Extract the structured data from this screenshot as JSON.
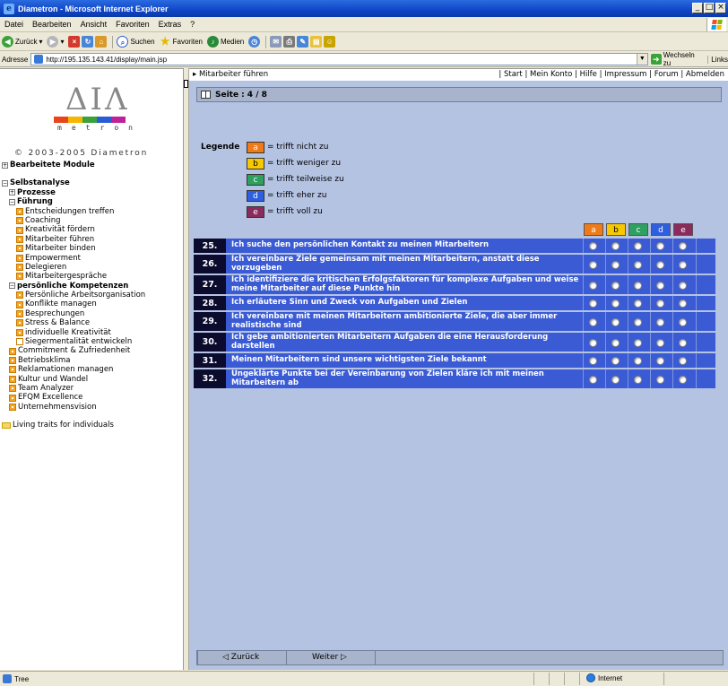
{
  "window": {
    "title": "Diametron - Microsoft Internet Explorer"
  },
  "menu": [
    "Datei",
    "Bearbeiten",
    "Ansicht",
    "Favoriten",
    "Extras",
    "?"
  ],
  "toolbar": {
    "back": "Zurück",
    "search": "Suchen",
    "favorites": "Favoriten",
    "media": "Medien"
  },
  "address": {
    "label": "Adresse",
    "url": "http://195.135.143.41/display/main.jsp",
    "go": "Wechseln zu",
    "links": "Links"
  },
  "logo": {
    "glyphs": "ΔΙΛ",
    "word": [
      "m",
      "e",
      "t",
      "r",
      "o",
      "n"
    ],
    "colors": [
      "#e8451a",
      "#f7b500",
      "#3aa23a",
      "#2a5cd6",
      "#c0219a"
    ]
  },
  "copyright": "© 2003-2005 Diametron",
  "nav": [
    {
      "label": "Bearbeitete Module",
      "level": 0,
      "type": "plus",
      "bold": true
    },
    {
      "label": "Selbstanalyse",
      "level": 0,
      "type": "minus",
      "bold": true
    },
    {
      "label": "Prozesse",
      "level": 1,
      "type": "plus",
      "bold": true
    },
    {
      "label": "Führung",
      "level": 1,
      "type": "minus",
      "bold": true
    },
    {
      "label": "Entscheidungen treffen",
      "level": 2,
      "type": "bullet"
    },
    {
      "label": "Coaching",
      "level": 2,
      "type": "bullet"
    },
    {
      "label": "Kreativität fördern",
      "level": 2,
      "type": "bullet"
    },
    {
      "label": "Mitarbeiter führen",
      "level": 2,
      "type": "bullet"
    },
    {
      "label": "Mitarbeiter binden",
      "level": 2,
      "type": "bullet"
    },
    {
      "label": "Empowerment",
      "level": 2,
      "type": "bullet"
    },
    {
      "label": "Delegieren",
      "level": 2,
      "type": "bullet"
    },
    {
      "label": "Mitarbeitergespräche",
      "level": 2,
      "type": "bullet"
    },
    {
      "label": "persönliche Kompetenzen",
      "level": 1,
      "type": "minus",
      "bold": true
    },
    {
      "label": "Persönliche Arbeitsorganisation",
      "level": 2,
      "type": "bullet"
    },
    {
      "label": "Konflikte managen",
      "level": 2,
      "type": "bullet"
    },
    {
      "label": "Besprechungen",
      "level": 2,
      "type": "bullet"
    },
    {
      "label": "Stress & Balance",
      "level": 2,
      "type": "bullet"
    },
    {
      "label": "individuelle Kreativität",
      "level": 2,
      "type": "bullet"
    },
    {
      "label": "Siegermentalität entwickeln",
      "level": 2,
      "type": "empty"
    },
    {
      "label": "Commitment & Zufriedenheit",
      "level": 1,
      "type": "bullet"
    },
    {
      "label": "Betriebsklima",
      "level": 1,
      "type": "bullet"
    },
    {
      "label": "Reklamationen managen",
      "level": 1,
      "type": "bullet"
    },
    {
      "label": "Kultur und Wandel",
      "level": 1,
      "type": "bullet"
    },
    {
      "label": "Team Analyzer",
      "level": 1,
      "type": "bullet"
    },
    {
      "label": "EFQM Excellence",
      "level": 1,
      "type": "bullet"
    },
    {
      "label": "Unternehmensvision",
      "level": 1,
      "type": "bullet"
    },
    {
      "label": "",
      "level": 0,
      "type": "spacer"
    },
    {
      "label": "Living traits for individuals",
      "level": 0,
      "type": "folder"
    }
  ],
  "topnav": {
    "crumb": "▸ Mitarbeiter führen",
    "links": "| Start | Mein Konto | Hilfe | Impressum | Forum | Abmelden"
  },
  "page": {
    "label": "Seite",
    "value": ": 4 / 8"
  },
  "legend": {
    "title": "Legende",
    "items": [
      {
        "key": "a",
        "color": "#f07a18",
        "text": "= trifft nicht zu"
      },
      {
        "key": "b",
        "color": "#f7c800",
        "text": "= trifft weniger zu"
      },
      {
        "key": "c",
        "color": "#2fa060",
        "text": "= trifft teilweise zu"
      },
      {
        "key": "d",
        "color": "#2e5fe0",
        "text": "= trifft eher zu"
      },
      {
        "key": "e",
        "color": "#8b2a5c",
        "text": "= trifft voll zu"
      }
    ]
  },
  "questions": [
    {
      "num": "25.",
      "text": "Ich suche den persönlichen Kontakt zu meinen Mitarbeitern"
    },
    {
      "num": "26.",
      "text": "Ich vereinbare Ziele gemeinsam mit meinen Mitarbeitern, anstatt diese vorzugeben"
    },
    {
      "num": "27.",
      "text": "Ich identifiziere die kritischen Erfolgsfaktoren für komplexe Aufgaben und weise meine Mitarbeiter auf diese Punkte hin"
    },
    {
      "num": "28.",
      "text": "Ich erläutere Sinn und Zweck von Aufgaben und Zielen"
    },
    {
      "num": "29.",
      "text": "Ich vereinbare mit meinen Mitarbeitern ambitionierte Ziele, die aber immer realistische sind"
    },
    {
      "num": "30.",
      "text": "Ich gebe ambitionierten Mitarbeitern Aufgaben die eine Herausforderung darstellen"
    },
    {
      "num": "31.",
      "text": "Meinen Mitarbeitern sind unsere wichtigsten Ziele bekannt"
    },
    {
      "num": "32.",
      "text": "Ungeklärte Punkte bei der Vereinbarung von Zielen kläre ich mit meinen Mitarbeitern ab"
    }
  ],
  "nav_buttons": {
    "back": "◁ Zurück",
    "next": "Weiter ▷"
  },
  "status": {
    "left": "Tree",
    "zone": "Internet"
  }
}
